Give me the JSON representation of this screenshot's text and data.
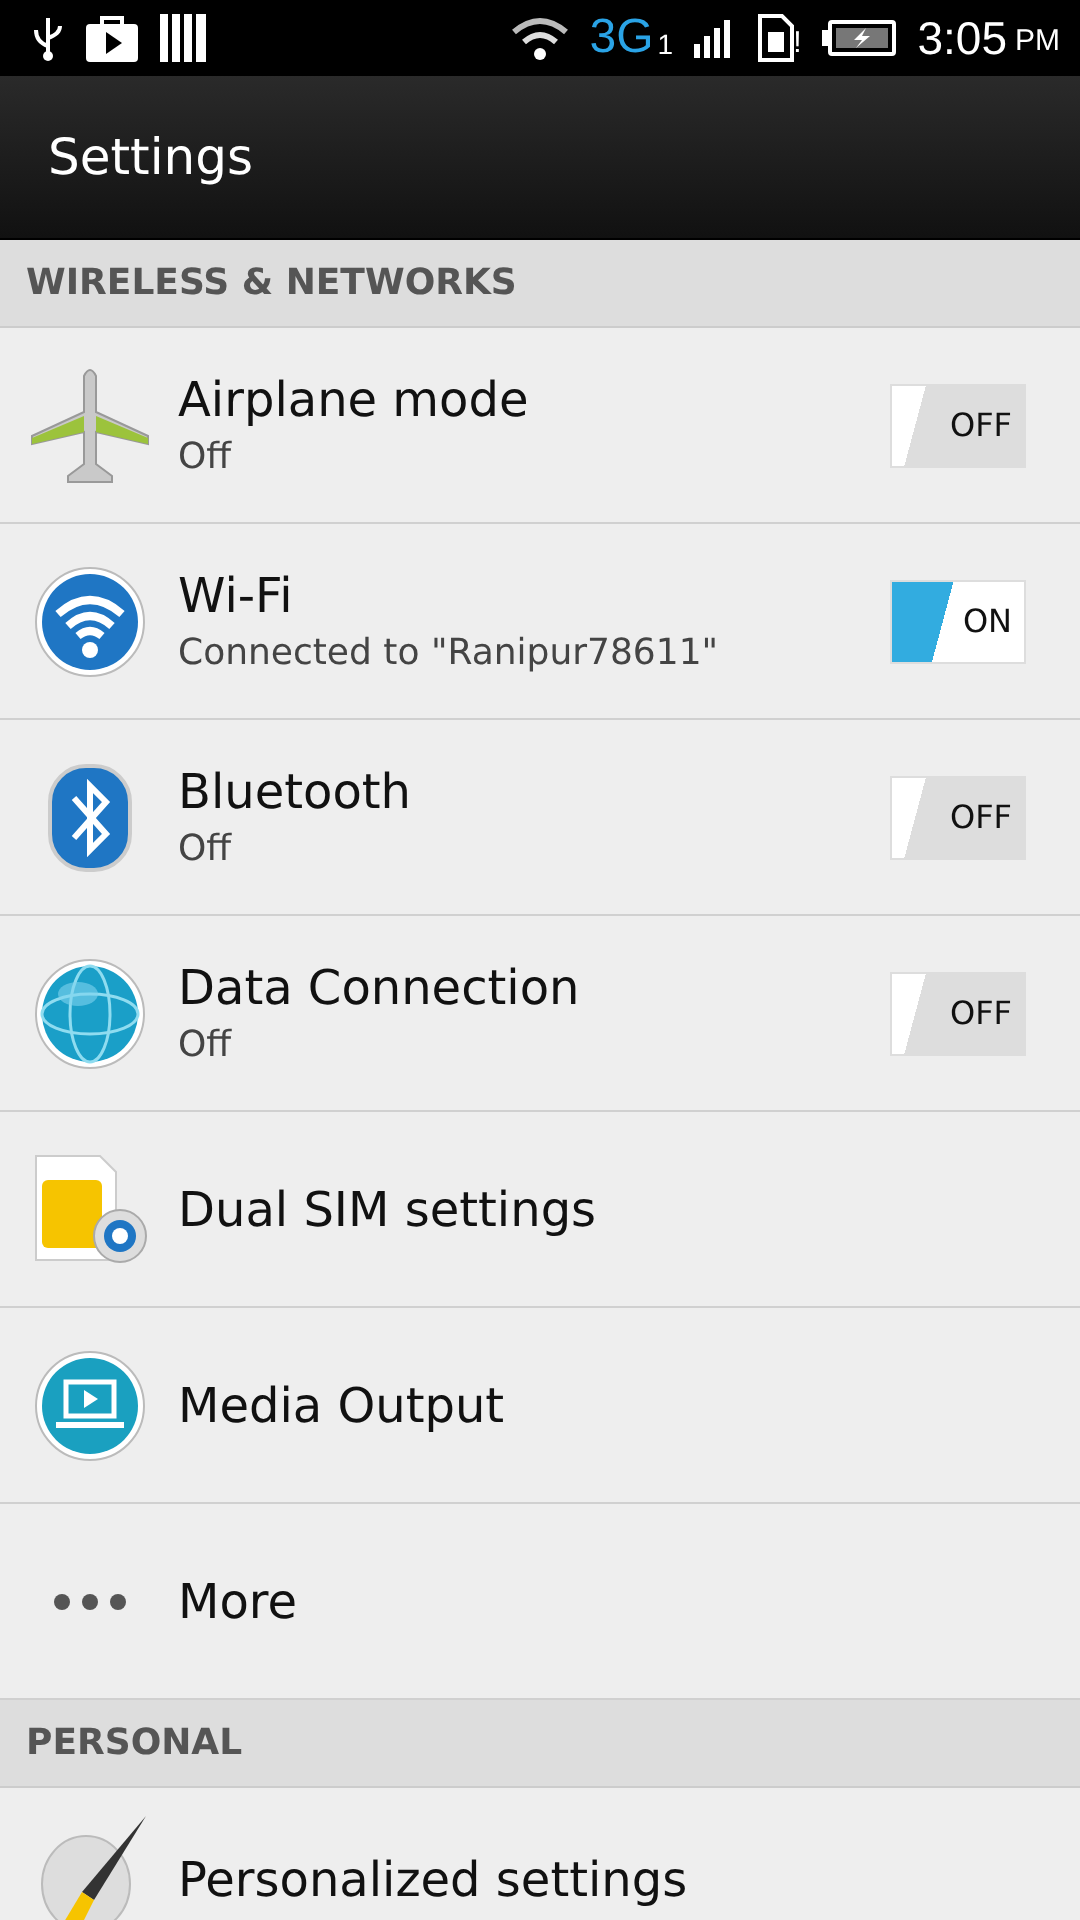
{
  "status_bar": {
    "network": "3G",
    "sim_slot": "1",
    "sim_alert": "!",
    "time": "3:05",
    "ampm": "PM"
  },
  "action_bar": {
    "title": "Settings"
  },
  "sections": [
    {
      "header": "WIRELESS & NETWORKS",
      "items": [
        {
          "title": "Airplane mode",
          "subtitle": "Off",
          "toggle": {
            "on": false,
            "label": "OFF"
          }
        },
        {
          "title": "Wi-Fi",
          "subtitle": "Connected to \"Ranipur78611\"",
          "toggle": {
            "on": true,
            "label": "ON"
          }
        },
        {
          "title": "Bluetooth",
          "subtitle": "Off",
          "toggle": {
            "on": false,
            "label": "OFF"
          }
        },
        {
          "title": "Data Connection",
          "subtitle": "Off",
          "toggle": {
            "on": false,
            "label": "OFF"
          }
        },
        {
          "title": "Dual SIM settings"
        },
        {
          "title": "Media Output"
        },
        {
          "title": "More"
        }
      ]
    },
    {
      "header": "PERSONAL",
      "items": [
        {
          "title": "Personalized settings"
        }
      ]
    }
  ]
}
